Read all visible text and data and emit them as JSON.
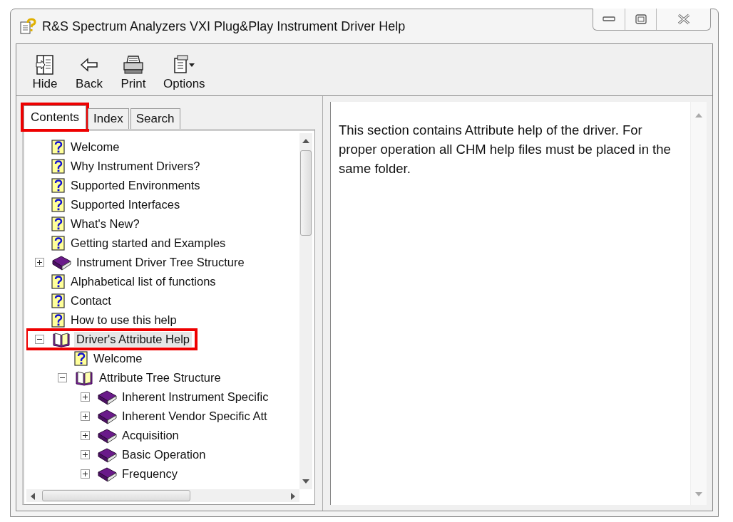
{
  "window": {
    "title": "R&S Spectrum Analyzers VXI Plug&Play Instrument Driver Help"
  },
  "toolbar": [
    {
      "label": "Hide",
      "kind": "hide"
    },
    {
      "label": "Back",
      "kind": "back"
    },
    {
      "label": "Print",
      "kind": "print"
    },
    {
      "label": "Options",
      "kind": "options"
    }
  ],
  "tabs": [
    {
      "label": "Contents",
      "selected": true,
      "highlighted": true
    },
    {
      "label": "Index",
      "selected": false,
      "highlighted": false
    },
    {
      "label": "Search",
      "selected": false,
      "highlighted": false
    }
  ],
  "tree": [
    {
      "label": "Welcome",
      "kind": "topic",
      "selected": false,
      "highlighted": false
    },
    {
      "label": "Why Instrument Drivers?",
      "kind": "topic",
      "selected": false,
      "highlighted": false
    },
    {
      "label": "Supported Environments",
      "kind": "topic",
      "selected": false,
      "highlighted": false
    },
    {
      "label": "Supported Interfaces",
      "kind": "topic",
      "selected": false,
      "highlighted": false
    },
    {
      "label": "What's New?",
      "kind": "topic",
      "selected": false,
      "highlighted": false
    },
    {
      "label": "Getting started and Examples",
      "kind": "topic",
      "selected": false,
      "highlighted": false
    },
    {
      "label": "Instrument Driver Tree Structure",
      "kind": "book",
      "expanded": false,
      "selected": false,
      "highlighted": false
    },
    {
      "label": "Alphabetical list of functions",
      "kind": "topic",
      "selected": false,
      "highlighted": false
    },
    {
      "label": "Contact",
      "kind": "topic",
      "selected": false,
      "highlighted": false
    },
    {
      "label": "How to use this help",
      "kind": "topic",
      "selected": false,
      "highlighted": false
    },
    {
      "label": "Driver's Attribute Help",
      "kind": "book",
      "expanded": true,
      "selected": true,
      "highlighted": true,
      "children": [
        {
          "label": "Welcome",
          "kind": "topic",
          "selected": false,
          "highlighted": false
        },
        {
          "label": "Attribute Tree Structure",
          "kind": "book",
          "expanded": true,
          "selected": false,
          "highlighted": false,
          "children": [
            {
              "label": "Inherent Instrument Specific",
              "kind": "book",
              "expanded": false,
              "selected": false,
              "highlighted": false
            },
            {
              "label": "Inherent Vendor Specific Att",
              "kind": "book",
              "expanded": false,
              "selected": false,
              "highlighted": false
            },
            {
              "label": "Acquisition",
              "kind": "book",
              "expanded": false,
              "selected": false,
              "highlighted": false
            },
            {
              "label": "Basic Operation",
              "kind": "book",
              "expanded": false,
              "selected": false,
              "highlighted": false
            },
            {
              "label": "Frequency",
              "kind": "book",
              "expanded": false,
              "selected": false,
              "highlighted": false
            }
          ]
        }
      ]
    }
  ],
  "content": {
    "text": "This section contains Attribute help of the driver. For proper operation all CHM help files must be placed in the same folder."
  }
}
